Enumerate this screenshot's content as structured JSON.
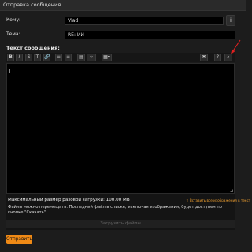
{
  "window": {
    "title": "Отправка сообщения"
  },
  "form": {
    "to_label": "Кому:",
    "to_value": "Vlad",
    "info_icon": "i",
    "subject_label": "Тема:",
    "subject_value": "RE: ИИ",
    "message_label": "Текст сообщения:"
  },
  "toolbar": {
    "left_buttons": [
      "B",
      "I",
      "S",
      "T",
      "🔗",
      "≡",
      "≡",
      "▤",
      "‹›",
      "▦▾"
    ],
    "right_buttons": [
      "✖",
      "?",
      "⌕"
    ]
  },
  "upload": {
    "max_size": "Максимальный размер разовой загрузки: 100.00 MB",
    "insert_all": "⇧ Вставить все изображения в текст",
    "description": "Файлы можно перемещать. Последний файл в списке, исключая изображения, будет доступен по кнопке \"Скачать\".",
    "upload_button": "Загрузить файлы"
  },
  "actions": {
    "send_label": "Отправить"
  },
  "colors": {
    "accent": "#f08a16",
    "annotation": "#e02020"
  }
}
